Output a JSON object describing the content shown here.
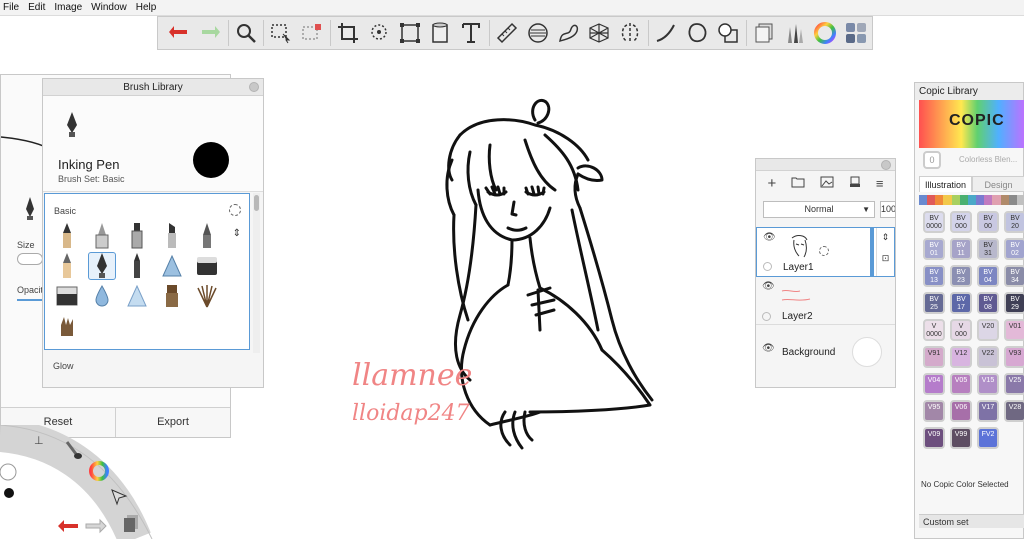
{
  "menu": [
    "File",
    "Edit",
    "Image",
    "Window",
    "Help"
  ],
  "toolbar": {
    "icons": [
      "undo-icon",
      "redo-icon",
      "zoom-icon",
      "select-icon",
      "selection-mask-icon",
      "crop-icon",
      "lasso-icon",
      "transform-icon",
      "fill-bucket-icon",
      "text-icon",
      "ruler-icon",
      "ellipse-guide-icon",
      "french-curve-icon",
      "perspective-icon",
      "symmetry-icon",
      "stroke-icon",
      "shape-icon",
      "copy-merged-icon",
      "layer-icon",
      "brush-set-icon",
      "color-wheel-icon",
      "copic-icon"
    ]
  },
  "brush_editor": {
    "size_label": "Size",
    "opacity_label": "Opacit",
    "reset_label": "Reset",
    "export_label": "Export"
  },
  "brush_library": {
    "title": "Brush Library",
    "brush_name": "Inking Pen",
    "brush_set": "Brush Set: Basic",
    "group_basic": "Basic",
    "group_glow": "Glow"
  },
  "layers": {
    "blend_mode": "Normal",
    "opacity": "100",
    "rows": [
      {
        "name": "Layer1"
      },
      {
        "name": "Layer2"
      },
      {
        "name": "Background"
      }
    ]
  },
  "copic": {
    "title": "Copic Library",
    "logo": "COPIC",
    "colorless": "Colorless Blen...",
    "colorless_code": "0",
    "tabs": [
      "Illustration",
      "Design"
    ],
    "swatches": [
      {
        "code": "BV\n0000",
        "color": "#dcdcee"
      },
      {
        "code": "BV\n000",
        "color": "#d3d3ea"
      },
      {
        "code": "BV\n00",
        "color": "#c9c8e2"
      },
      {
        "code": "BV\n20",
        "color": "#c1c4e0"
      },
      {
        "code": "BV\n01",
        "color": "#a7a9d0"
      },
      {
        "code": "BV\n11",
        "color": "#a6a3c8"
      },
      {
        "code": "BV\n31",
        "color": "#b8b8cc"
      },
      {
        "code": "BV\n02",
        "color": "#a1a4cf"
      },
      {
        "code": "BV\n13",
        "color": "#8890c6"
      },
      {
        "code": "BV\n23",
        "color": "#8b8fb2"
      },
      {
        "code": "BV\n04",
        "color": "#7c86c2"
      },
      {
        "code": "BV\n34",
        "color": "#8a8ca8"
      },
      {
        "code": "BV\n25",
        "color": "#656a95"
      },
      {
        "code": "BV\n17",
        "color": "#5d68a8"
      },
      {
        "code": "BV\n08",
        "color": "#5f5a92"
      },
      {
        "code": "BV\n29",
        "color": "#3f3f55"
      },
      {
        "code": "V\n0000",
        "color": "#ecdfe9"
      },
      {
        "code": "V\n000",
        "color": "#e6d8e6"
      },
      {
        "code": "V20",
        "color": "#dcd6e6"
      },
      {
        "code": "V01",
        "color": "#e3b9d8"
      },
      {
        "code": "V91",
        "color": "#d4aacb"
      },
      {
        "code": "V12",
        "color": "#d8b4e0"
      },
      {
        "code": "V22",
        "color": "#c9c2d6"
      },
      {
        "code": "V93",
        "color": "#d7a8d2"
      },
      {
        "code": "V04",
        "color": "#b57ccb"
      },
      {
        "code": "V05",
        "color": "#b77fbf"
      },
      {
        "code": "V15",
        "color": "#b08fc8"
      },
      {
        "code": "V25",
        "color": "#8a79a9"
      },
      {
        "code": "V95",
        "color": "#a287a8"
      },
      {
        "code": "V06",
        "color": "#a76fa9"
      },
      {
        "code": "V17",
        "color": "#7e72a6"
      },
      {
        "code": "V28",
        "color": "#6f6882"
      },
      {
        "code": "V09",
        "color": "#6d4f7e"
      },
      {
        "code": "V99",
        "color": "#5e4e63"
      },
      {
        "code": "FV2",
        "color": "#5c73d8"
      }
    ],
    "no_color": "No Copic Color Selected",
    "custom_set": "Custom set"
  },
  "signature": {
    "line1": "llamnee",
    "line2": "lloidap247",
    "color": "#f08585"
  }
}
